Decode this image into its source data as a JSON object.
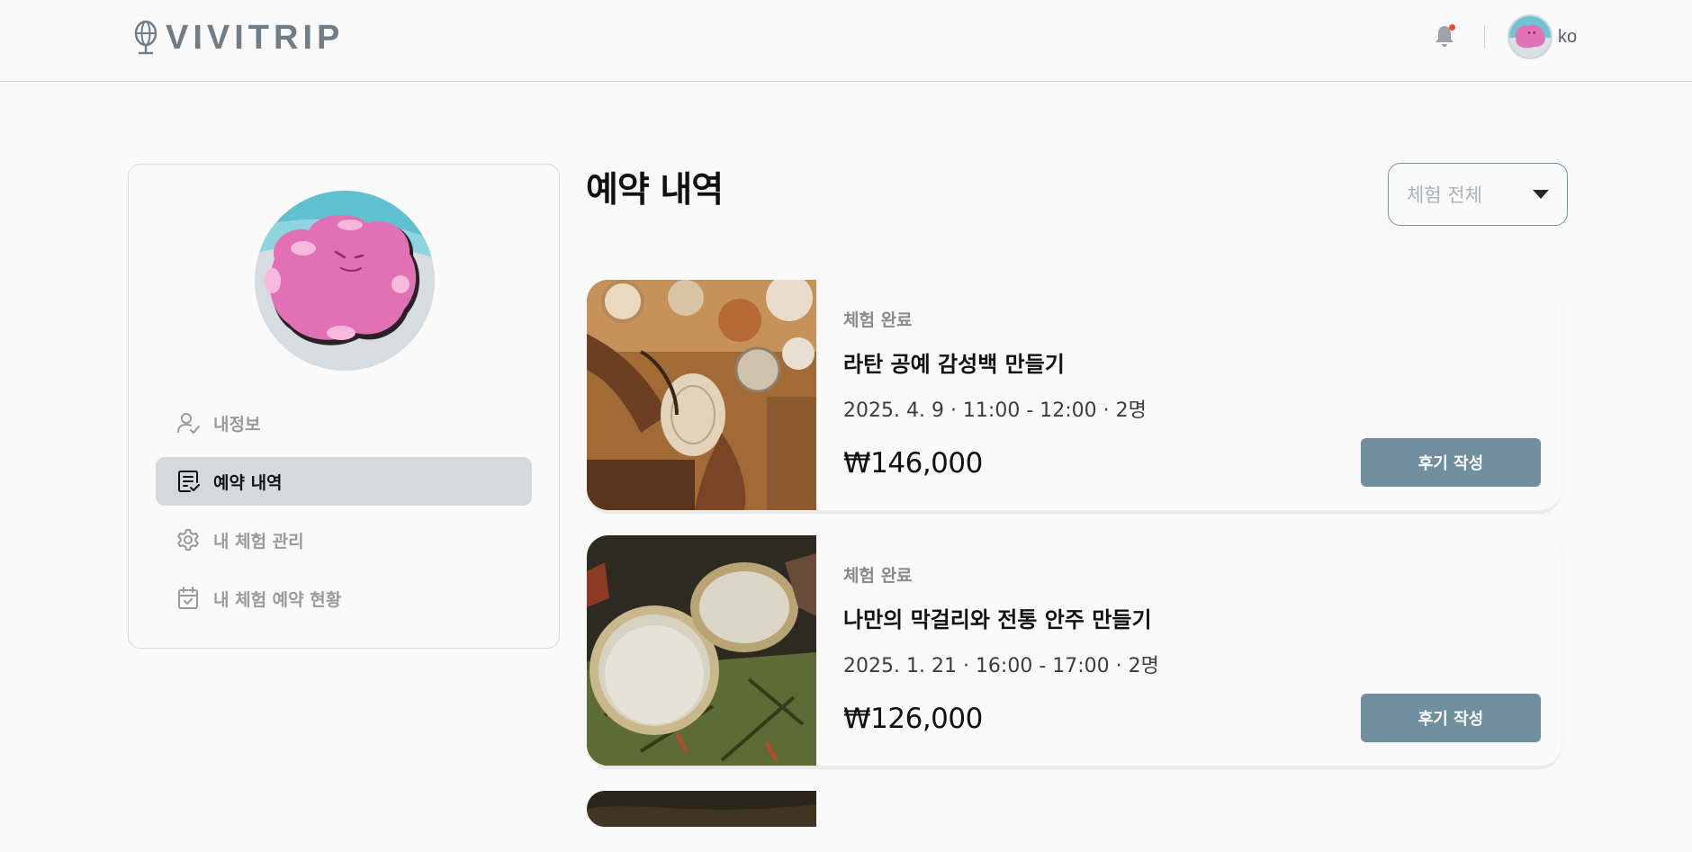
{
  "header": {
    "logo_text": "VIVITRIP",
    "notification_badge": true,
    "user_name": "ko",
    "icons": [
      "globe-pin-icon",
      "bell-icon"
    ]
  },
  "sidebar": {
    "items": [
      {
        "label": "내정보",
        "icon": "user-check-icon",
        "active": false
      },
      {
        "label": "예약 내역",
        "icon": "list-check-icon",
        "active": true
      },
      {
        "label": "내 체험 관리",
        "icon": "gear-icon",
        "active": false
      },
      {
        "label": "내 체험 예약 현황",
        "icon": "calendar-check-icon",
        "active": false
      }
    ]
  },
  "main": {
    "title": "예약 내역",
    "filter": {
      "selected": "체험 전체",
      "icon": "caret-down-icon"
    },
    "reservations": [
      {
        "status": "체험 완료",
        "title": "라탄 공예 감성백 만들기",
        "schedule": "2025. 4. 9 · 11:00 - 12:00 · 2명",
        "price": "₩146,000",
        "action": "후기 작성"
      },
      {
        "status": "체험 완료",
        "title": "나만의 막걸리와 전통 안주 만들기",
        "schedule": "2025. 1. 21 · 16:00 - 17:00 · 2명",
        "price": "₩126,000",
        "action": "후기 작성"
      }
    ]
  },
  "colors": {
    "accent": "#6f8f9e",
    "active_nav_bg": "#d3d9dc",
    "notification_dot": "#ef4a2c",
    "logo": "#707c86"
  }
}
